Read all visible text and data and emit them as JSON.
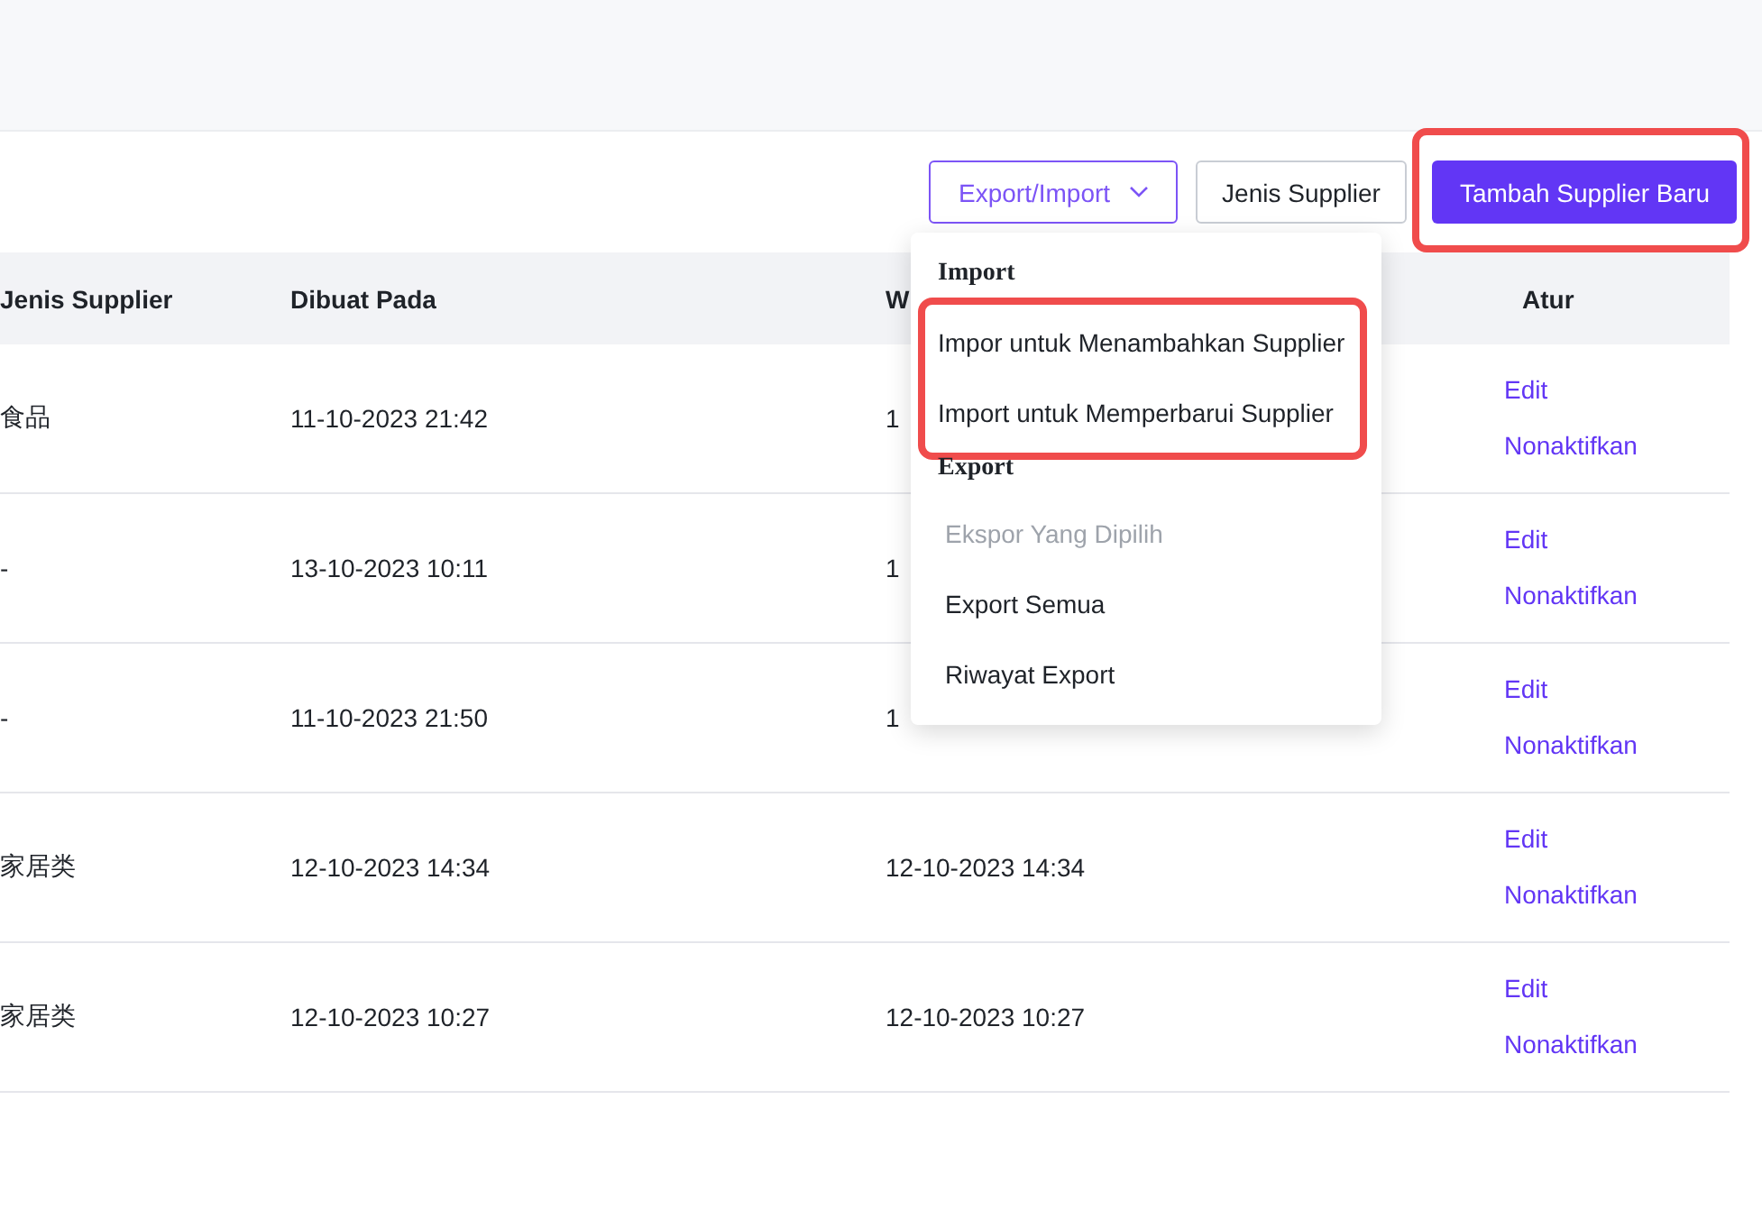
{
  "toolbar": {
    "dropdown_button": {
      "label": "Export/Import",
      "expanded": true
    },
    "type_button": {
      "label": "Jenis Supplier"
    },
    "add_button": {
      "label": "Tambah Supplier Baru",
      "highlighted": true
    }
  },
  "table": {
    "columns": [
      "Jenis Supplier",
      "Dibuat Pada",
      "W",
      "Atur"
    ],
    "rows": [
      {
        "cells": [
          "食品",
          "11-10-2023 21:42",
          "1"
        ],
        "actions": [
          "Edit",
          "Nonaktifkan"
        ]
      },
      {
        "cells": [
          "-",
          "13-10-2023 10:11",
          "1"
        ],
        "actions": [
          "Edit",
          "Nonaktifkan"
        ]
      },
      {
        "cells": [
          "-",
          "11-10-2023 21:50",
          "1"
        ],
        "actions": [
          "Edit",
          "Nonaktifkan"
        ]
      },
      {
        "cells": [
          "家居类",
          "12-10-2023 14:34",
          "12-10-2023 14:34"
        ],
        "actions": [
          "Edit",
          "Nonaktifkan"
        ]
      },
      {
        "cells": [
          "家居类",
          "12-10-2023 10:27",
          "12-10-2023 10:27"
        ],
        "actions": [
          "Edit",
          "Nonaktifkan"
        ]
      }
    ]
  },
  "dropdown_menu": {
    "sections": [
      {
        "title": "Import",
        "highlighted": true,
        "items": [
          {
            "label": "Impor untuk Menambahkan Supplier",
            "disabled": false
          },
          {
            "label": "Import untuk Memperbarui Supplier",
            "disabled": false
          }
        ]
      },
      {
        "title": "Export",
        "highlighted": false,
        "items": [
          {
            "label": "Ekspor Yang Dipilih",
            "disabled": true
          },
          {
            "label": "Export Semua",
            "disabled": false
          },
          {
            "label": "Riwayat Export",
            "disabled": false
          }
        ]
      }
    ]
  }
}
